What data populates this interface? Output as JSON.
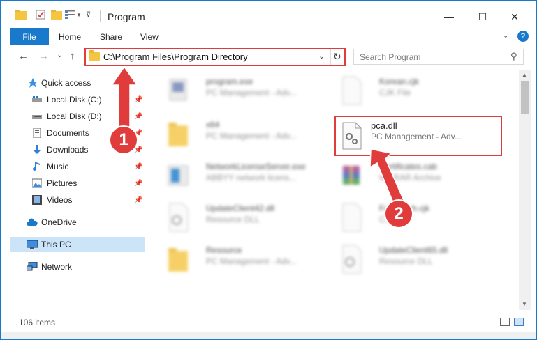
{
  "window": {
    "title": "Program",
    "minimize": "—",
    "maximize": "☐",
    "close": "✕"
  },
  "ribbon": {
    "file": "File",
    "home": "Home",
    "share": "Share",
    "view": "View",
    "help": "?"
  },
  "navbar": {
    "back": "←",
    "forward": "→",
    "recent": "⌄",
    "up": "↑",
    "address": "C:\\Program Files\\Program Directory",
    "search_placeholder": "Search Program"
  },
  "sidebar": {
    "items": [
      {
        "label": "Quick access",
        "icon": "star-icon",
        "pinned": false
      },
      {
        "label": "Local Disk (C:)",
        "icon": "drive-icon",
        "pinned": true
      },
      {
        "label": "Local Disk (D:)",
        "icon": "drive-icon",
        "pinned": true
      },
      {
        "label": "Documents",
        "icon": "documents-icon",
        "pinned": true
      },
      {
        "label": "Downloads",
        "icon": "downloads-icon",
        "pinned": true
      },
      {
        "label": "Music",
        "icon": "music-icon",
        "pinned": true
      },
      {
        "label": "Pictures",
        "icon": "pictures-icon",
        "pinned": true
      },
      {
        "label": "Videos",
        "icon": "videos-icon",
        "pinned": true
      },
      {
        "label": "OneDrive",
        "icon": "cloud-icon",
        "pinned": false
      },
      {
        "label": "This PC",
        "icon": "computer-icon",
        "pinned": false,
        "selected": true
      },
      {
        "label": "Network",
        "icon": "network-icon",
        "pinned": false
      }
    ]
  },
  "files": [
    {
      "name": "program.exe",
      "desc": "PC Management - Adv...",
      "icon": "exe-icon"
    },
    {
      "name": "Korean.cjk",
      "desc": "CJK File",
      "icon": "file-icon"
    },
    {
      "name": "x64",
      "desc": "PC Management - Adv...",
      "icon": "folder-icon"
    },
    {
      "name": "pca.dll",
      "desc": "PC Management - Adv...",
      "icon": "dll-gear-icon",
      "highlighted": true
    },
    {
      "name": "NetworkLicenseServer.exe",
      "desc": "ABBYY network licens...",
      "icon": "exe-icon"
    },
    {
      "name": "Certificates.cab",
      "desc": "WinRAR Archive",
      "icon": "archive-icon"
    },
    {
      "name": "UpdateClient42.dll",
      "desc": "Resource DLL",
      "icon": "dll-gear-icon"
    },
    {
      "name": "FastBatch.cjk",
      "desc": "CJK File",
      "icon": "file-icon"
    },
    {
      "name": "Resource",
      "desc": "PC Management - Adv...",
      "icon": "folder-icon"
    },
    {
      "name": "UpdateClient65.dll",
      "desc": "Resource DLL",
      "icon": "dll-gear-icon"
    }
  ],
  "status": {
    "count": "106 items"
  },
  "annotations": {
    "step1": "1",
    "step2": "2"
  },
  "colors": {
    "accent": "#1979ca",
    "highlight": "#e03c3c"
  }
}
